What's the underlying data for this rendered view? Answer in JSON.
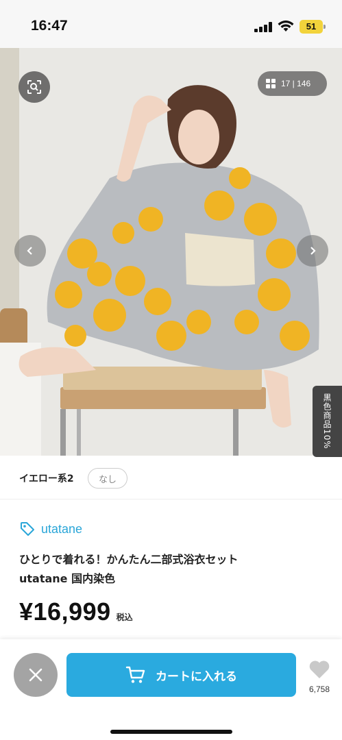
{
  "status_bar": {
    "time": "16:47",
    "battery": "51"
  },
  "gallery": {
    "counter": "17 | 146"
  },
  "side_tab": {
    "label": "黒色商品10%"
  },
  "color_option": {
    "selected_color": "イエロー系2",
    "size_chip": "なし"
  },
  "product": {
    "brand": "utatane",
    "title_line1": "ひとりで着れる！かんたん二部式浴衣セット",
    "title_line2": "utatane 国内染色",
    "price": "¥16,999",
    "tax_note": "税込"
  },
  "actions": {
    "cart_label": "カートに入れる",
    "like_count": "6,758"
  },
  "colors": {
    "accent": "#2aaadf",
    "brand_text": "#2aa6d8",
    "close_bg": "#a4a4a4",
    "yukata_flower": "#f0b424",
    "yukata_base": "#b9bcc0"
  }
}
